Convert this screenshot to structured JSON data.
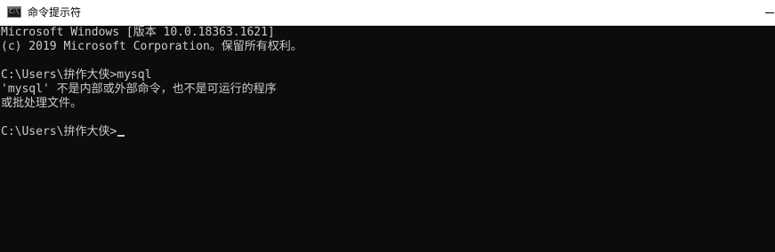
{
  "window": {
    "title": "命令提示符",
    "icon_name": "cmd-icon",
    "icon_text": "C:\\"
  },
  "console": {
    "lines": [
      "Microsoft Windows [版本 10.0.18363.1621]",
      "(c) 2019 Microsoft Corporation。保留所有权利。",
      "",
      "C:\\Users\\拚作大侠>mysql",
      "'mysql' 不是内部或外部命令，也不是可运行的程序",
      "或批处理文件。",
      "",
      "C:\\Users\\拚作大侠>"
    ],
    "background_color": "#0c0c0c",
    "text_color": "#cccccc"
  }
}
